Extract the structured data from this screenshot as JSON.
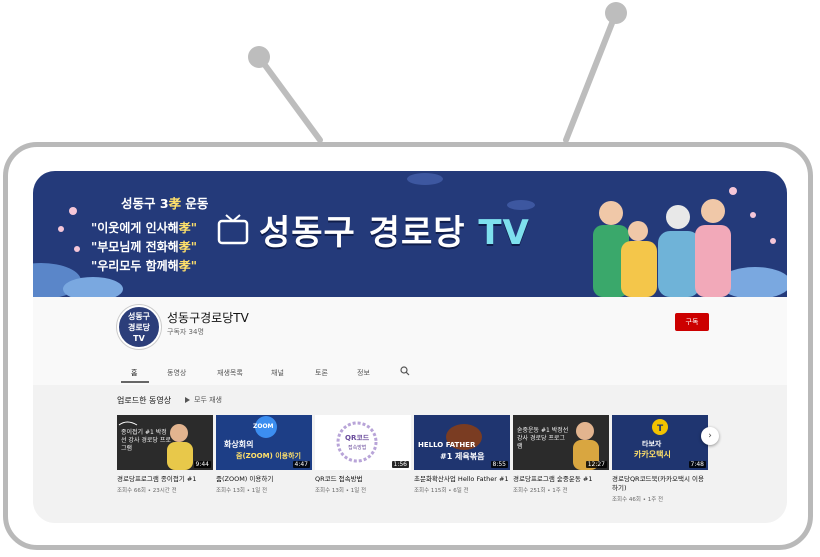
{
  "banner": {
    "slogan_head": "성동구 3",
    "slogan_head_hl": "孝",
    "slogan_head_tail": " 운동",
    "slogan_1": "\"이웃에게 인사해",
    "slogan_2": "\"부모님께 전화해",
    "slogan_3": "\"우리모두 함께해",
    "slogan_hl": "孝\"",
    "title_main": "성동구 경로당 ",
    "title_tv": "TV"
  },
  "channel": {
    "avatar_line1": "성동구",
    "avatar_line2": "경로당",
    "avatar_line3": "TV",
    "name": "성동구경로당TV",
    "subscribers": "구독자 34명",
    "subscribe_label": "구독"
  },
  "tabs": [
    {
      "label": "홈"
    },
    {
      "label": "동영상"
    },
    {
      "label": "재생목록"
    },
    {
      "label": "채널"
    },
    {
      "label": "토론"
    },
    {
      "label": "정보"
    }
  ],
  "section": {
    "title": "업로드한 동영상",
    "play_all": "모두 재생"
  },
  "videos": [
    {
      "title": "경로당프로그램 종이접기 #1",
      "meta": "조회수 66회 • 23시간 전",
      "duration": "9:44",
      "thumb_text": "종이접기 #1 박정선 강사 경로당 프로그램"
    },
    {
      "title": "줌(ZOOM) 이용하기",
      "meta": "조회수 13회 • 1일 전",
      "duration": "4:47",
      "thumb_text_1": "ZOOM",
      "thumb_text_2": "화상회의",
      "thumb_text_3": "줌(ZOOM) 이용하기"
    },
    {
      "title": "QR코드 접속방법",
      "meta": "조회수 13회 • 1일 전",
      "duration": "1:56",
      "thumb_text_1": "QR코드",
      "thumb_text_2": "접속방법"
    },
    {
      "title": "초문화확산사업 Hello Father #1",
      "meta": "조회수 115회 • 6일 전",
      "duration": "8:55",
      "thumb_text_1": "HELLO FATHER",
      "thumb_text_2": "#1 제육볶음"
    },
    {
      "title": "경로당프로그램 숟중운동 #1",
      "meta": "조회수 251회 • 1주 전",
      "duration": "12:27",
      "thumb_text": "숟중운동 #1 박정선 강사 경로당 프로그램"
    },
    {
      "title": "경로당QR코드북(카카오택시 이용하기)",
      "meta": "조회수 46회 • 1주 전",
      "duration": "7:48",
      "thumb_text_1": "타보자",
      "thumb_text_2": "카카오택시"
    }
  ],
  "colors": {
    "banner_bg": "#243a7a",
    "subscribe": "#cc0000",
    "frame": "#b9b9b9"
  }
}
